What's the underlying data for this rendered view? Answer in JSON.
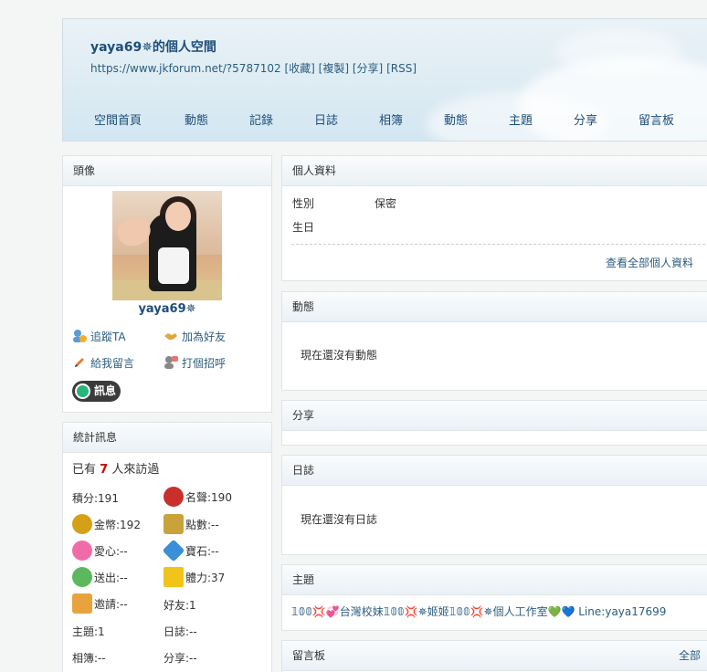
{
  "header": {
    "title": "yaya69✵的個人空間",
    "url": "https://www.jkforum.net/?5787102",
    "links": [
      "[收藏]",
      "[複製]",
      "[分享]",
      "[RSS]"
    ],
    "nav": [
      "空間首頁",
      "動態",
      "記錄",
      "日誌",
      "相簿",
      "動態",
      "主題",
      "分享",
      "留言板"
    ]
  },
  "avatar_panel": {
    "title": "頭像",
    "username": "yaya69✵",
    "actions": [
      "追蹤TA",
      "加為好友",
      "給我留言",
      "打個招呼"
    ],
    "message_button": "訊息"
  },
  "stats_panel": {
    "title": "統計訊息",
    "visit_prefix": "已有",
    "visit_count": "7",
    "visit_suffix": "人來訪過",
    "items": {
      "points": "積分:191",
      "fame": "名聲:190",
      "coins": "金幣:192",
      "dots": "點數:--",
      "love": "愛心:--",
      "gem": "寶石:--",
      "sent": "送出:--",
      "energy": "體力:37",
      "invite": "邀請:--",
      "friends": "好友:1",
      "topics": "主題:1",
      "blogs": "日誌:--",
      "albums": "相簿:--",
      "shares": "分享:--"
    },
    "icon_colors": {
      "fame": "#c9302c",
      "coins": "#d4a017",
      "love": "#f06ca8",
      "gem": "#3a8fd8",
      "sent": "#5cb85c",
      "energy": "#f0c419",
      "invite": "#e8a33d"
    }
  },
  "profile_panel": {
    "title": "個人資料",
    "gender_label": "性別",
    "gender_value": "保密",
    "birthday_label": "生日",
    "view_all": "查看全部個人資料"
  },
  "activity_panel": {
    "title": "動態",
    "empty": "現在還沒有動態"
  },
  "share_panel": {
    "title": "分享"
  },
  "blog_panel": {
    "title": "日誌",
    "empty": "現在還沒有日誌"
  },
  "topic_panel": {
    "title": "主題",
    "topic": "𝟙𝟘𝟘💢💞台灣校妹𝟙𝟘𝟘💢✵姬姬𝟙𝟘𝟘💢✵個人工作室💚💙 Line:yaya17699"
  },
  "guestbook_panel": {
    "title": "留言板",
    "all_link": "全部"
  }
}
